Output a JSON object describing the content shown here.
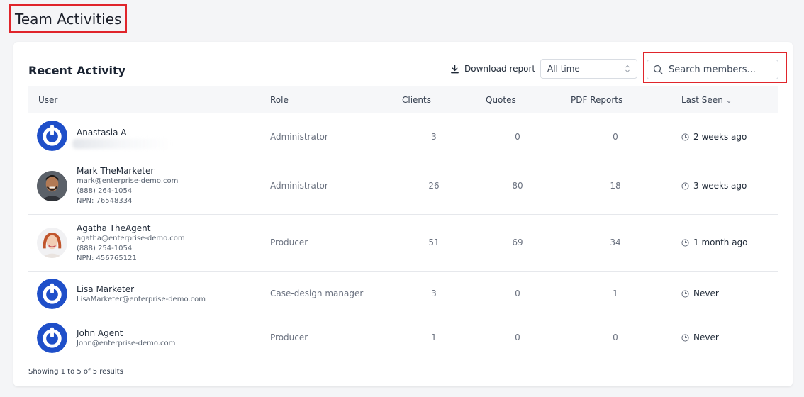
{
  "page": {
    "title": "Team Activities"
  },
  "card": {
    "title": "Recent Activity",
    "download_label": "Download report",
    "time_filter": "All time",
    "search_placeholder": "Search members..."
  },
  "table": {
    "headers": {
      "user": "User",
      "role": "Role",
      "clients": "Clients",
      "quotes": "Quotes",
      "pdf": "PDF Reports",
      "last_seen": "Last Seen"
    },
    "rows": [
      {
        "name": "Anastasia A",
        "email": "",
        "phone": "",
        "npn": "",
        "role": "Administrator",
        "clients": "3",
        "quotes": "0",
        "pdf": "0",
        "last_seen": "2 weeks ago",
        "avatar": "logo-icon"
      },
      {
        "name": "Mark TheMarketer",
        "email": "mark@enterprise-demo.com",
        "phone": "(888) 264-1054",
        "npn": "NPN: 76548334",
        "role": "Administrator",
        "clients": "26",
        "quotes": "80",
        "pdf": "18",
        "last_seen": "3 weeks ago",
        "avatar": "male-photo"
      },
      {
        "name": "Agatha TheAgent",
        "email": "agatha@enterprise-demo.com",
        "phone": "(888) 254-1054",
        "npn": "NPN: 456765121",
        "role": "Producer",
        "clients": "51",
        "quotes": "69",
        "pdf": "34",
        "last_seen": "1 month ago",
        "avatar": "female-photo"
      },
      {
        "name": "Lisa Marketer",
        "email": "LisaMarketer@enterprise-demo.com",
        "phone": "",
        "npn": "",
        "role": "Case-design manager",
        "clients": "3",
        "quotes": "0",
        "pdf": "1",
        "last_seen": "Never",
        "avatar": "logo-icon"
      },
      {
        "name": "John Agent",
        "email": "John@enterprise-demo.com",
        "phone": "",
        "npn": "",
        "role": "Producer",
        "clients": "1",
        "quotes": "0",
        "pdf": "0",
        "last_seen": "Never",
        "avatar": "logo-icon"
      }
    ]
  },
  "footer": {
    "summary": "Showing 1 to 5 of 5 results"
  },
  "colors": {
    "accent": "#1f4fc9",
    "highlight": "#e0252b"
  }
}
